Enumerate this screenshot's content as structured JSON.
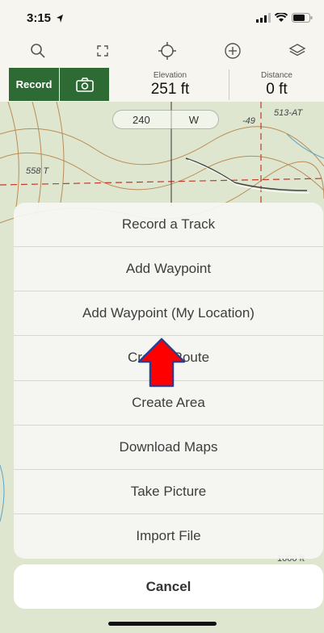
{
  "status": {
    "time": "3:15"
  },
  "stats": {
    "record_label": "Record",
    "elevation_label": "Elevation",
    "elevation_value": "251 ft",
    "distance_label": "Distance",
    "distance_value": "0 ft"
  },
  "map": {
    "heading_value": "240",
    "heading_dir": "W",
    "labels": [
      "513-AT",
      "-49",
      "558 T",
      "1000 ft"
    ]
  },
  "toolbar": {
    "icons": [
      "search-icon",
      "expand-icon",
      "locate-crosshair-icon",
      "add-circle-icon",
      "layers-icon"
    ]
  },
  "menu": {
    "items": [
      "Record a Track",
      "Add Waypoint",
      "Add Waypoint (My Location)",
      "Create Route",
      "Create Area",
      "Download Maps",
      "Take Picture",
      "Import File"
    ],
    "cancel_label": "Cancel"
  },
  "annotation": {
    "arrow_color": "#ff0000"
  }
}
